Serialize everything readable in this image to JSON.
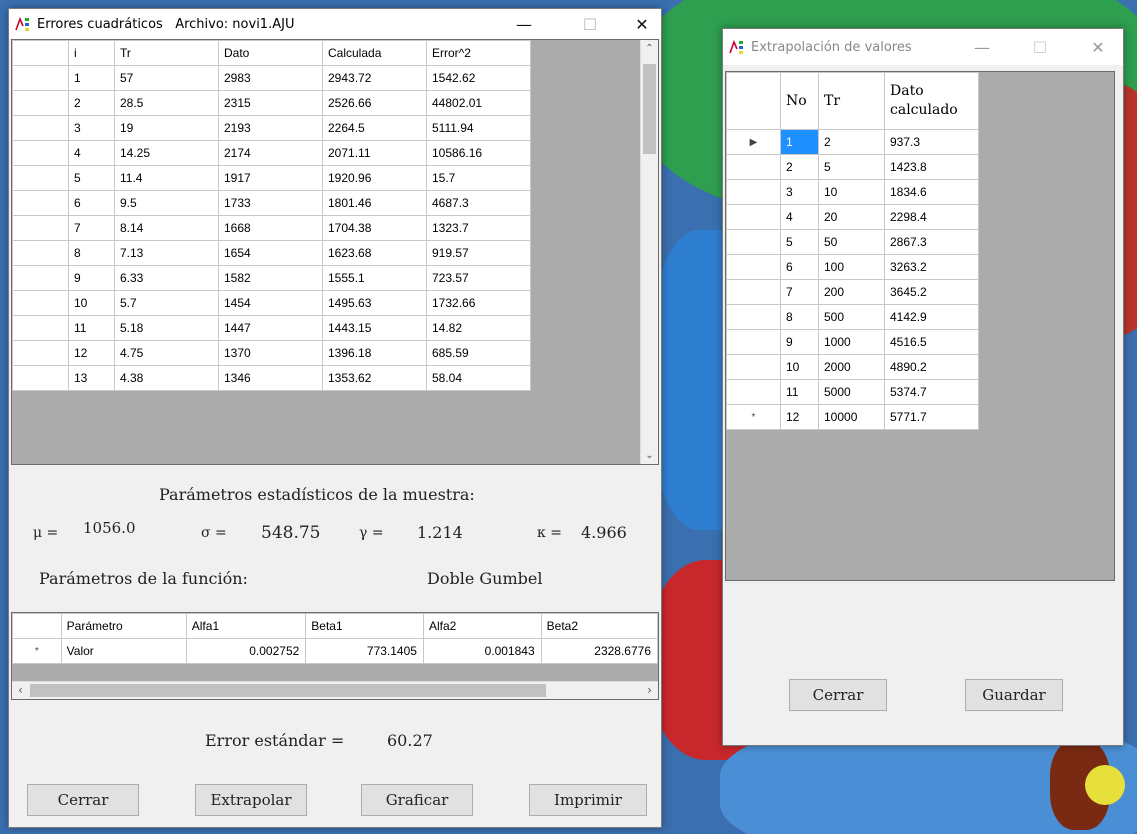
{
  "colors": {
    "window_bg": "#f0f0f0",
    "grid_bg": "#ababab",
    "selection": "#1e90ff"
  },
  "main_window": {
    "title": "Errores cuadráticos   Archivo: novi1.AJU",
    "controls": {
      "minimize": "—",
      "maximize": "☐",
      "close": "✕"
    },
    "table": {
      "headers": [
        "i",
        "Tr",
        "Dato",
        "Calculada",
        "Error^2"
      ],
      "rows": [
        [
          "1",
          "57",
          "2983",
          "2943.72",
          "1542.62"
        ],
        [
          "2",
          "28.5",
          "2315",
          "2526.66",
          "44802.01"
        ],
        [
          "3",
          "19",
          "2193",
          "2264.5",
          "5111.94"
        ],
        [
          "4",
          "14.25",
          "2174",
          "2071.11",
          "10586.16"
        ],
        [
          "5",
          "11.4",
          "1917",
          "1920.96",
          "15.7"
        ],
        [
          "6",
          "9.5",
          "1733",
          "1801.46",
          "4687.3"
        ],
        [
          "7",
          "8.14",
          "1668",
          "1704.38",
          "1323.7"
        ],
        [
          "8",
          "7.13",
          "1654",
          "1623.68",
          "919.57"
        ],
        [
          "9",
          "6.33",
          "1582",
          "1555.1",
          "723.57"
        ],
        [
          "10",
          "5.7",
          "1454",
          "1495.63",
          "1732.66"
        ],
        [
          "11",
          "5.18",
          "1447",
          "1443.15",
          "14.82"
        ],
        [
          "12",
          "4.75",
          "1370",
          "1396.18",
          "685.59"
        ],
        [
          "13",
          "4.38",
          "1346",
          "1353.62",
          "58.04"
        ]
      ]
    },
    "stats": {
      "heading": "Parámetros estadísticos de la muestra:",
      "mu_label": "μ =",
      "mu_value": "1056.0",
      "sigma_label": "σ =",
      "sigma_value": "548.75",
      "gamma_label": "γ =",
      "gamma_value": "1.214",
      "kappa_label": "κ =",
      "kappa_value": "4.966"
    },
    "function": {
      "label": "Parámetros de la función:",
      "name": "Doble Gumbel"
    },
    "params_table": {
      "headers": [
        "Parámetro",
        "Alfa1",
        "Beta1",
        "Alfa2",
        "Beta2"
      ],
      "row_marker": "*",
      "row": [
        "Valor",
        "0.002752",
        "773.1405",
        "0.001843",
        "2328.6776"
      ]
    },
    "error_label": "Error estándar =",
    "error_value": "60.27",
    "buttons": {
      "close": "Cerrar",
      "extrapolate": "Extrapolar",
      "plot": "Graficar",
      "print": "Imprimir"
    }
  },
  "extrap_window": {
    "title": "Extrapolación de valores",
    "controls": {
      "minimize": "—",
      "maximize": "☐",
      "close": "✕"
    },
    "table": {
      "headers": [
        "No",
        "Tr",
        "Dato calculado"
      ],
      "rows": [
        [
          "1",
          "2",
          "937.3"
        ],
        [
          "2",
          "5",
          "1423.8"
        ],
        [
          "3",
          "10",
          "1834.6"
        ],
        [
          "4",
          "20",
          "2298.4"
        ],
        [
          "5",
          "50",
          "2867.3"
        ],
        [
          "6",
          "100",
          "3263.2"
        ],
        [
          "7",
          "200",
          "3645.2"
        ],
        [
          "8",
          "500",
          "4142.9"
        ],
        [
          "9",
          "1000",
          "4516.5"
        ],
        [
          "10",
          "2000",
          "4890.2"
        ],
        [
          "11",
          "5000",
          "5374.7"
        ],
        [
          "12",
          "10000",
          "5771.7"
        ]
      ],
      "current_marker": "▶",
      "new_row_marker": "*"
    },
    "buttons": {
      "close": "Cerrar",
      "save": "Guardar"
    }
  }
}
